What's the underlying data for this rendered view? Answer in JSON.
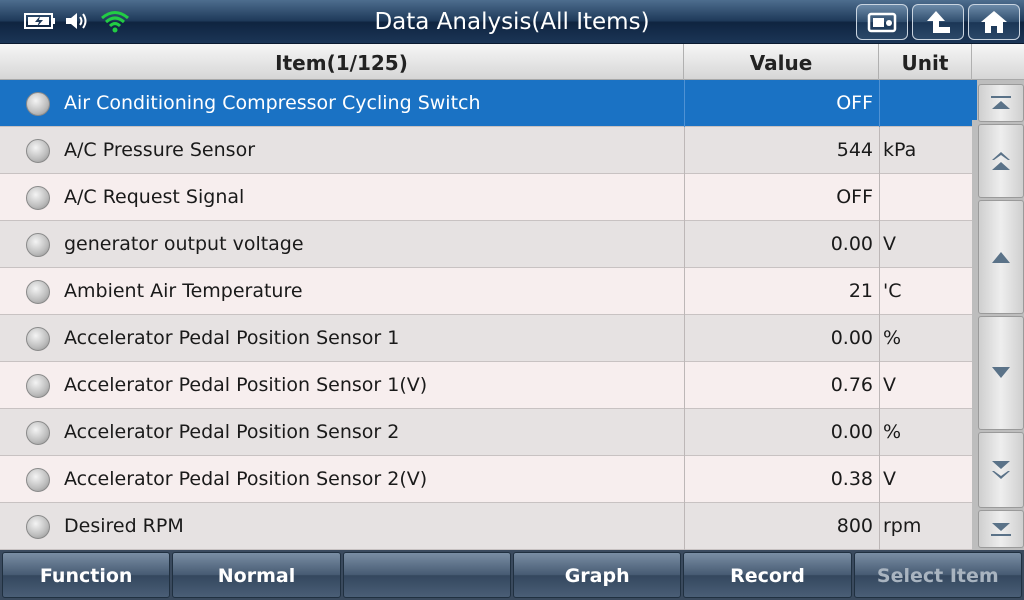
{
  "title": "Data Analysis(All Items)",
  "header": {
    "item": "Item(1/125)",
    "value": "Value",
    "unit": "Unit"
  },
  "rows": [
    {
      "name": "Air Conditioning Compressor Cycling Switch",
      "value": "OFF",
      "unit": ""
    },
    {
      "name": "A/C Pressure Sensor",
      "value": "544",
      "unit": "kPa"
    },
    {
      "name": "A/C Request Signal",
      "value": "OFF",
      "unit": ""
    },
    {
      "name": "generator output voltage",
      "value": "0.00",
      "unit": "V"
    },
    {
      "name": "Ambient Air Temperature",
      "value": "21",
      "unit": "'C"
    },
    {
      "name": "Accelerator Pedal Position Sensor 1",
      "value": "0.00",
      "unit": "%"
    },
    {
      "name": "Accelerator Pedal Position Sensor 1(V)",
      "value": "0.76",
      "unit": "V"
    },
    {
      "name": "Accelerator Pedal Position Sensor 2",
      "value": "0.00",
      "unit": "%"
    },
    {
      "name": "Accelerator Pedal Position Sensor 2(V)",
      "value": "0.38",
      "unit": "V"
    },
    {
      "name": "Desired RPM",
      "value": "800",
      "unit": "rpm"
    }
  ],
  "bottom": {
    "function": "Function",
    "normal": "Normal",
    "blank": "",
    "graph": "Graph",
    "record": "Record",
    "select_item": "Select Item"
  },
  "colors": {
    "selected_row": "#1a72c4",
    "wifi": "#22cc44"
  },
  "icons": {
    "battery": "battery-charging-icon",
    "volume": "speaker-icon",
    "wifi": "wifi-icon",
    "screenshot": "screenshot-icon",
    "back": "back-arrow-icon",
    "home": "home-icon"
  }
}
